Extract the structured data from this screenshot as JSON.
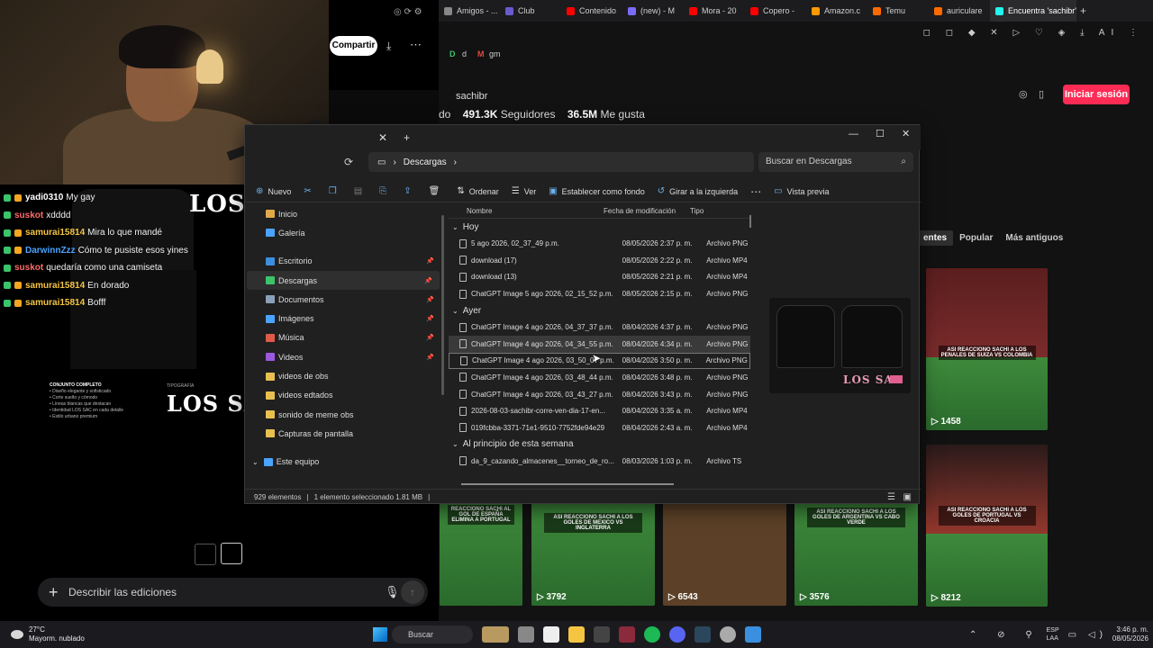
{
  "streamer": {
    "chat": [
      {
        "user": "yadi0310",
        "msg": "My gay",
        "color": "#ffffff"
      },
      {
        "user": "suskot",
        "msg": "xdddd",
        "color": "#ff6b6b"
      },
      {
        "user": "samurai15814",
        "msg": "Mira lo que mandé",
        "color": "#f5c542"
      },
      {
        "user": "DarwinnZzz",
        "msg": "Cómo te pusiste esos yines",
        "color": "#4aa3ff"
      },
      {
        "user": "suskot",
        "msg": "quedaría como una camiseta",
        "color": "#ff6b6b"
      },
      {
        "user": "samurai15814",
        "msg": "En dorado",
        "color": "#f5c542"
      },
      {
        "user": "samurai15814",
        "msg": "Bofff",
        "color": "#f5c542"
      }
    ],
    "design": {
      "logo_top": "LOS SAC",
      "logo_bottom": "LOS SAC",
      "spec_title": "CONJUNTO COMPLETO",
      "spec_lines": [
        "• Diseño elegante y sofisticado",
        "• Corte suelto y cómodo",
        "• Líneas blancas que destacan",
        "• Identidad LOS SAC en cada detalle",
        "• Estilo urbano premium"
      ],
      "typo_label": "TIPOGRAFÍA"
    },
    "prompt_placeholder": "Describir las ediciones",
    "share_label": "Compartir"
  },
  "browser": {
    "tabs": [
      {
        "label": "Amigos - ...",
        "color": "#888888"
      },
      {
        "label": "Club",
        "color": "#6a5acd"
      },
      {
        "label": "Contenido",
        "color": "#ff0000"
      },
      {
        "label": "(new) - M",
        "color": "#7a6cff"
      },
      {
        "label": "Mora - 20",
        "color": "#ff0000"
      },
      {
        "label": "Copero -",
        "color": "#ff0000"
      },
      {
        "label": "Amazon.c",
        "color": "#ff9900"
      },
      {
        "label": "Temu",
        "color": "#ff6a00"
      },
      {
        "label": "auriculare",
        "color": "#ff6a00"
      },
      {
        "label": "Encuentra 'sachibr'",
        "color": "#25f4ee",
        "active": true
      }
    ],
    "bookmarks": [
      "d",
      "gm"
    ],
    "profile": {
      "handle": "sachibr",
      "following_label": "do",
      "followers": "491.3K",
      "followers_label": "Seguidores",
      "likes": "36.5M",
      "likes_label": "Me gusta"
    },
    "login_label": "Iniciar sesión",
    "filters": [
      "entes",
      "Popular",
      "Más antiguos"
    ],
    "videos": [
      {
        "views": "1458",
        "caption": "ASI REACCIONO SACHI A LOS PENALES DE SUIZA VS COLOMBIA"
      },
      {
        "views": "",
        "caption": "ASI REACCIONO SACHI A LOS GOLES DE PORTUGAL VS CROACIA"
      },
      {
        "views": "",
        "caption": "REACCIONO SACHI AL GOL DE ESPAÑA ELIMINA A PORTUGAL"
      },
      {
        "views": "3792",
        "caption": "ASI REACCIONO SACHI A LOS GOLES DE MEXICO VS INGLATERRA"
      },
      {
        "views": "6543",
        "caption": ""
      },
      {
        "views": "3576",
        "caption": "ASI REACCIONO SACHI A LOS GOLES DE ARGENTINA VS CABO VERDE"
      },
      {
        "views": "8212",
        "caption": ""
      }
    ]
  },
  "explorer": {
    "tab_title": "Descargas",
    "path": "Descargas",
    "search_placeholder": "Buscar en Descargas",
    "commands": [
      "Nuevo",
      "Ordenar",
      "Ver",
      "Establecer como fondo",
      "Girar a la izquierda",
      "Vista previa"
    ],
    "nav": [
      {
        "label": "Inicio",
        "color": "#e0a84a",
        "pin": false
      },
      {
        "label": "Galería",
        "color": "#4aa3ff",
        "pin": false
      },
      {
        "label": "Escritorio",
        "color": "#3b8fe0",
        "pin": true
      },
      {
        "label": "Descargas",
        "color": "#3bc46a",
        "pin": true,
        "sel": true
      },
      {
        "label": "Documentos",
        "color": "#8aa0b8",
        "pin": true
      },
      {
        "label": "Imágenes",
        "color": "#4aa3ff",
        "pin": true
      },
      {
        "label": "Música",
        "color": "#e05a4a",
        "pin": true
      },
      {
        "label": "Videos",
        "color": "#9b59e0",
        "pin": true
      },
      {
        "label": "videos de obs",
        "color": "#e8c050",
        "pin": false
      },
      {
        "label": "videos edtados",
        "color": "#e8c050",
        "pin": false
      },
      {
        "label": "sonido de meme obs",
        "color": "#e8c050",
        "pin": false
      },
      {
        "label": "Capturas de pantalla",
        "color": "#e8c050",
        "pin": false
      },
      {
        "label": "Este equipo",
        "color": "#4aa3ff",
        "pin": false
      }
    ],
    "columns": [
      "Nombre",
      "Fecha de modificación",
      "Tipo"
    ],
    "groups": [
      {
        "name": "Hoy",
        "files": [
          {
            "name": "5 ago 2026, 02_37_49 p.m.",
            "date": "08/05/2026 2:37 p. m.",
            "type": "Archivo PNG"
          },
          {
            "name": "download (17)",
            "date": "08/05/2026 2:22 p. m.",
            "type": "Archivo MP4"
          },
          {
            "name": "download (13)",
            "date": "08/05/2026 2:21 p. m.",
            "type": "Archivo MP4"
          },
          {
            "name": "ChatGPT Image 5 ago 2026, 02_15_52 p.m.",
            "date": "08/05/2026 2:15 p. m.",
            "type": "Archivo PNG"
          }
        ]
      },
      {
        "name": "Ayer",
        "files": [
          {
            "name": "ChatGPT Image 4 ago 2026, 04_37_37 p.m.",
            "date": "08/04/2026 4:37 p. m.",
            "type": "Archivo PNG"
          },
          {
            "name": "ChatGPT Image 4 ago 2026, 04_34_55 p.m.",
            "date": "08/04/2026 4:34 p. m.",
            "type": "Archivo PNG",
            "sel": true
          },
          {
            "name": "ChatGPT Image 4 ago 2026, 03_50_07 p.m.",
            "date": "08/04/2026 3:50 p. m.",
            "type": "Archivo PNG",
            "hi": true
          },
          {
            "name": "ChatGPT Image 4 ago 2026, 03_48_44 p.m.",
            "date": "08/04/2026 3:48 p. m.",
            "type": "Archivo PNG"
          },
          {
            "name": "ChatGPT Image 4 ago 2026, 03_43_27 p.m.",
            "date": "08/04/2026 3:43 p. m.",
            "type": "Archivo PNG"
          },
          {
            "name": "2026-08-03-sachibr-corre-ven-dia-17-en...",
            "date": "08/04/2026 3:35 a. m.",
            "type": "Archivo MP4"
          },
          {
            "name": "019fcbba-3371-71e1-9510-7752fde94e29",
            "date": "08/04/2026 2:43 a. m.",
            "type": "Archivo MP4"
          }
        ]
      },
      {
        "name": "Al principio de esta semana",
        "files": [
          {
            "name": "da_9_cazando_almacenes__torneo_de_ro...",
            "date": "08/03/2026 1:03 p. m.",
            "type": "Archivo TS"
          }
        ]
      }
    ],
    "status": {
      "count": "929 elementos",
      "selected": "1 elemento seleccionado  1.81 MB"
    },
    "preview_logo": "LOS SAC"
  },
  "taskbar": {
    "weather_temp": "27°C",
    "weather_desc": "Mayorm. nublado",
    "search_label": "Buscar",
    "lang": "ESP",
    "lang2": "LAA",
    "time": "3:46 p. m.",
    "date": "08/05/2026"
  }
}
